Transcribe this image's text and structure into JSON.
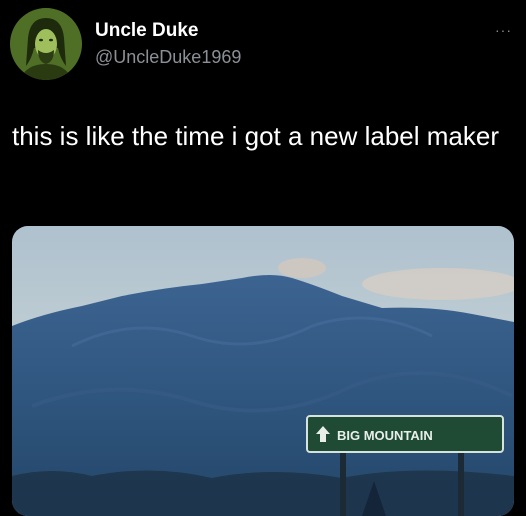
{
  "author": {
    "display_name": "Uncle Duke",
    "handle": "@UncleDuke1969",
    "avatar_icon": "portrait-avatar"
  },
  "menu": {
    "more_label": "···"
  },
  "tweet": {
    "text": "this is like the time i got a new label maker"
  },
  "media": {
    "sign_text": "BIG MOUNTAIN",
    "sign_arrow": "up-arrow-icon",
    "sign_color": "#1f4a34"
  }
}
